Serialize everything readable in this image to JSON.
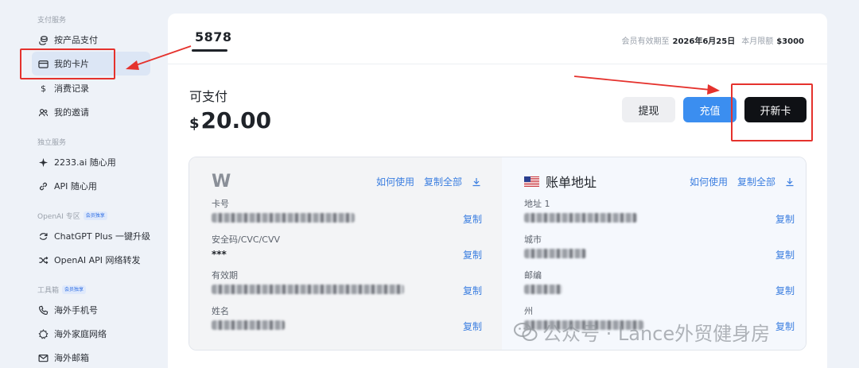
{
  "sidebar": {
    "groups": [
      {
        "title": "支付服务",
        "badge": ""
      },
      {
        "title": "独立服务",
        "badge": ""
      },
      {
        "title": "OpenAI 专区",
        "badge": "会员独享"
      },
      {
        "title": "工具箱",
        "badge": "会员独享"
      }
    ],
    "items": [
      {
        "label": "按产品支付",
        "icon": "coins-icon"
      },
      {
        "label": "我的卡片",
        "icon": "credit-card-icon"
      },
      {
        "label": "消费记录",
        "icon": "dollar-icon"
      },
      {
        "label": "我的邀请",
        "icon": "users-icon"
      },
      {
        "label": "2233.ai 随心用",
        "icon": "sparkle-icon"
      },
      {
        "label": "API 随心用",
        "icon": "link-icon"
      },
      {
        "label": "ChatGPT Plus 一键升级",
        "icon": "refresh-icon"
      },
      {
        "label": "OpenAI API 网络转发",
        "icon": "shuffle-icon"
      },
      {
        "label": "海外手机号",
        "icon": "phone-icon"
      },
      {
        "label": "海外家庭网络",
        "icon": "network-icon"
      },
      {
        "label": "海外邮箱",
        "icon": "mail-icon"
      }
    ],
    "active_item": "我的卡片"
  },
  "header": {
    "card_tab": "5878",
    "expiry_label": "会员有效期至",
    "expiry_value": "2026年6月25日",
    "limit_label": "本月限额",
    "limit_value": "$3000"
  },
  "balance": {
    "label": "可支付",
    "currency": "$",
    "amount": "20.00"
  },
  "actions": {
    "withdraw": "提现",
    "recharge": "充值",
    "new_card": "开新卡"
  },
  "card_panel": {
    "brand": "W",
    "how_to_use": "如何使用",
    "copy_all": "复制全部",
    "fields": [
      {
        "label": "卡号",
        "value": "",
        "masked": true,
        "copy": "复制"
      },
      {
        "label": "安全码/CVC/CVV",
        "value": "***",
        "masked": false,
        "copy": "复制"
      },
      {
        "label": "有效期",
        "value": "",
        "masked": true,
        "copy": "复制"
      },
      {
        "label": "姓名",
        "value": "",
        "masked": true,
        "copy": "复制"
      }
    ]
  },
  "billing_panel": {
    "title": "账单地址",
    "how_to_use": "如何使用",
    "copy_all": "复制全部",
    "fields": [
      {
        "label": "地址 1",
        "value": "",
        "masked": true,
        "copy": "复制"
      },
      {
        "label": "城市",
        "value": "",
        "masked": true,
        "copy": "复制"
      },
      {
        "label": "邮编",
        "value": "",
        "masked": true,
        "copy": "复制"
      },
      {
        "label": "州",
        "value": "",
        "masked": true,
        "copy": "复制"
      }
    ]
  },
  "watermark": "公众号 · Lance外贸健身房",
  "colors": {
    "accent": "#3b8ef0",
    "link": "#3b7ee0",
    "annotation": "#e5322d",
    "primary_dark": "#0f1115"
  }
}
